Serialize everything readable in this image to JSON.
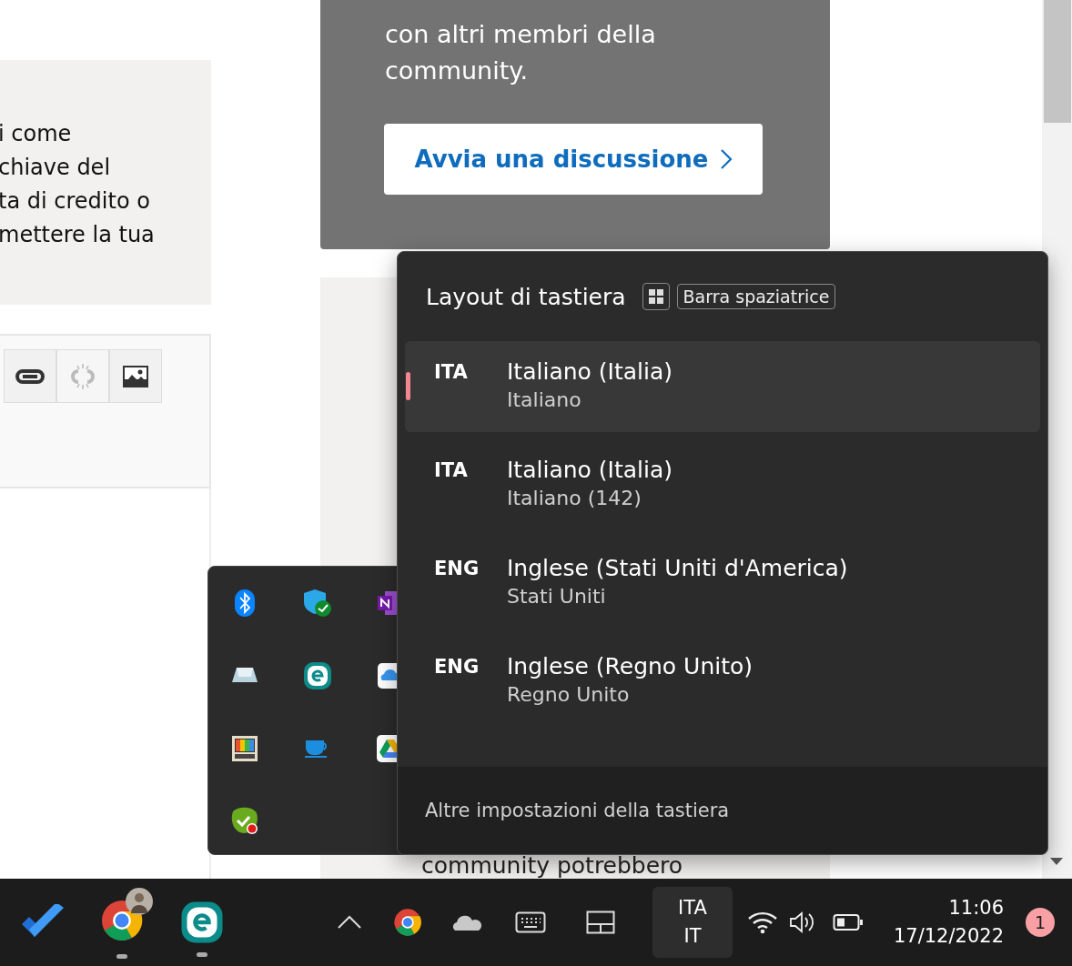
{
  "page": {
    "left_card_lines": [
      "i come",
      "chiave del",
      "ta di credito o",
      "mettere la tua"
    ],
    "center_card_lines": [
      "con altri membri della",
      "community."
    ],
    "discussion_button": "Avvia una discussione",
    "lower_text": "community potrebbero"
  },
  "keyboard_flyout": {
    "title": "Layout di tastiera",
    "shortcut_key": "Barra spaziatrice",
    "layouts": [
      {
        "code": "ITA",
        "name": "Italiano (Italia)",
        "detail": "Italiano",
        "selected": true
      },
      {
        "code": "ITA",
        "name": "Italiano (Italia)",
        "detail": "Italiano (142)",
        "selected": false
      },
      {
        "code": "ENG",
        "name": "Inglese (Stati Uniti d'America)",
        "detail": "Stati Uniti",
        "selected": false
      },
      {
        "code": "ENG",
        "name": "Inglese (Regno Unito)",
        "detail": "Regno Unito",
        "selected": false
      }
    ],
    "footer": "Altre impostazioni della tastiera"
  },
  "taskbar": {
    "input_indicator": [
      "ITA",
      "IT"
    ],
    "time": "11:06",
    "date": "17/12/2022",
    "notification_count": "1"
  }
}
